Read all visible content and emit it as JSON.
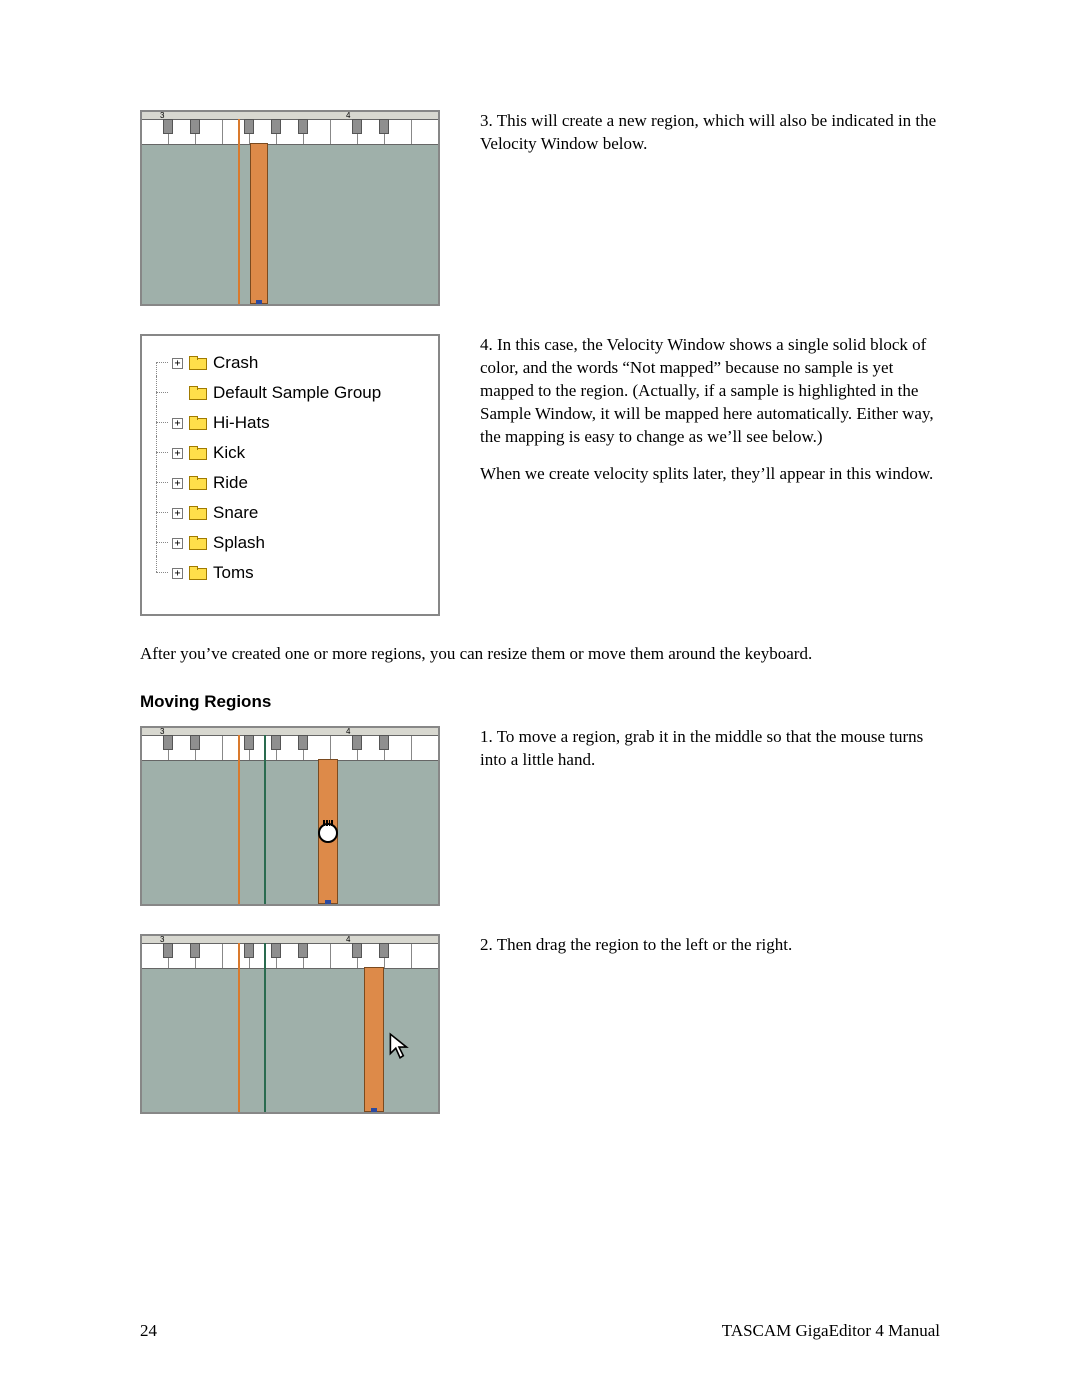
{
  "steps": {
    "s3": "3. This will create a new region, which will also be indicated in the Velocity Window below.",
    "s4a": "4. In this case, the Velocity Window shows a single solid block of color, and the words “Not mapped” because no sample is yet mapped to the region. (Actually, if a sample is highlighted in the Sample Window, it will be mapped here automatically. Either way, the mapping is easy to change as we’ll see below.)",
    "s4b": "When we create velocity splits later, they’ll appear in this window."
  },
  "after_regions": "After you’ve created one or more regions, you can resize them or move them around the keyboard.",
  "heading_moving": "Moving Regions",
  "moving": {
    "m1": "1. To move a region, grab it in the middle so that the mouse turns into a little hand.",
    "m2": "2. Then drag the region to the left or the right."
  },
  "tree_items": [
    {
      "label": "Crash",
      "expandable": true
    },
    {
      "label": "Default Sample Group",
      "expandable": false
    },
    {
      "label": "Hi-Hats",
      "expandable": true
    },
    {
      "label": "Kick",
      "expandable": true
    },
    {
      "label": "Ride",
      "expandable": true
    },
    {
      "label": "Snare",
      "expandable": true
    },
    {
      "label": "Splash",
      "expandable": true
    },
    {
      "label": "Toms",
      "expandable": true
    }
  ],
  "ruler_labels": {
    "left": "3",
    "right": "4"
  },
  "footer": {
    "page": "24",
    "title": "TASCAM GigaEditor 4 Manual"
  }
}
